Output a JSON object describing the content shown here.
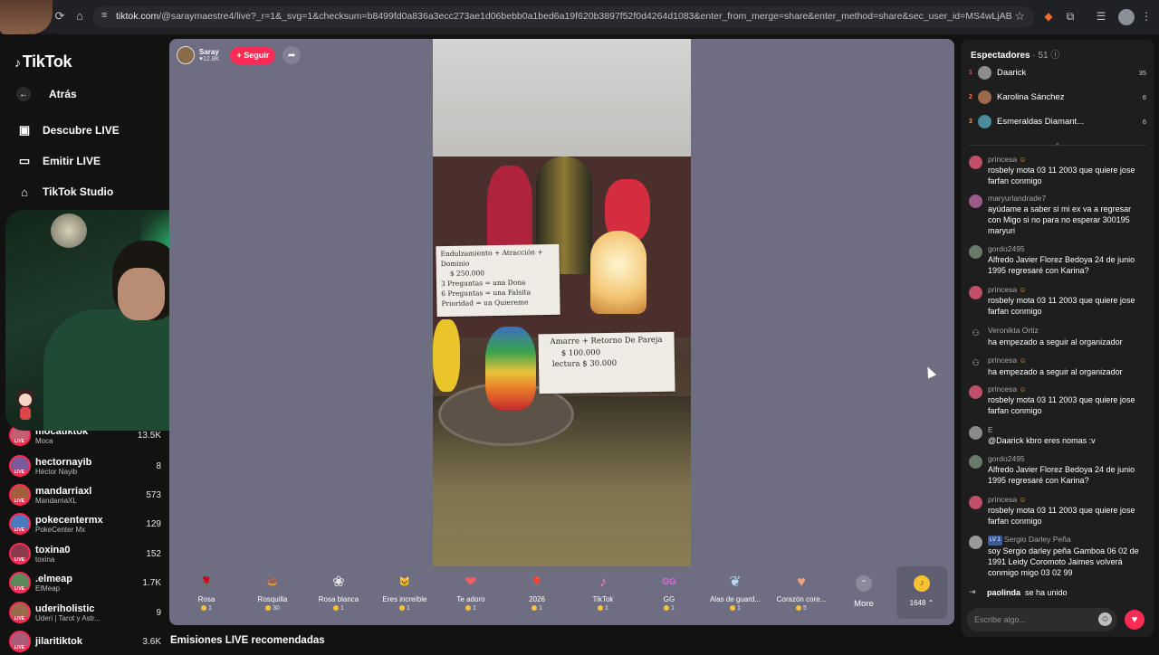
{
  "browser": {
    "url_host": "tiktok.com",
    "url_rest": "/@saraymaestre4/live?_r=1&_svg=1&checksum=b8499fd0a836a3ecc273ae1d06bebb0a1bed6a19f620b3897f52f0d4264d1083&enter_from_merge=share&enter_method=share&sec_user_id=MS4wLjABAAAAzrDx76MkaB1fEXR_...",
    "icons": [
      "back-icon",
      "reload-icon",
      "home-icon",
      "tune-icon",
      "star-icon",
      "extension-icon",
      "puzzle-icon",
      "media-icon",
      "profile-icon",
      "menu-icon"
    ]
  },
  "streamer_overlay": {
    "tag": "c1272"
  },
  "sidebar": {
    "logo": "TikTok",
    "back": "Atrás",
    "nav": [
      {
        "label": "Descubre LIVE",
        "icon": "live-icon"
      },
      {
        "label": "Emitir LIVE",
        "icon": "camera-icon"
      },
      {
        "label": "TikTok Studio",
        "icon": "studio-icon"
      }
    ],
    "following": [
      {
        "name": "mocatiktok",
        "sub": "Moca",
        "count": "13.5K",
        "color": "#c06070"
      },
      {
        "name": "hectornayib",
        "sub": "Héctor Nayib",
        "count": "8",
        "color": "#7a5a9a"
      },
      {
        "name": "mandarriaxl",
        "sub": "MandarriaXL",
        "count": "573",
        "color": "#a0603a"
      },
      {
        "name": "pokecentermx",
        "sub": "PokeCenter Mx",
        "count": "129",
        "color": "#4a7ac0"
      },
      {
        "name": "toxina0",
        "sub": "toxina",
        "count": "152",
        "color": "#8a3a4a"
      },
      {
        "name": ".elmeap",
        "sub": "ElMeap",
        "count": "1.7K",
        "color": "#5a8a5a"
      },
      {
        "name": "uderiholistic",
        "sub": "Uderi | Tarot y Astr...",
        "count": "9",
        "color": "#9a6a4a"
      },
      {
        "name": "jilaritiktok",
        "sub": "",
        "count": "3.6K",
        "color": "#aa5a7a"
      }
    ],
    "live_tag": "LIVE"
  },
  "host": {
    "name": "Saray",
    "likes": "12.8K",
    "follow_label": "+ Seguir"
  },
  "video_cards": {
    "card1": [
      "Endulzamiento + Atracción + Dominio",
      "$ 250.000",
      "3 Preguntas = una Dona",
      "6 Preguntas = una Falsita",
      "Prioridad = un Quiereme"
    ],
    "card2": [
      "Amarre + Retorno De Pareja",
      "$ 100.000",
      "lectura $ 30.000"
    ]
  },
  "gifts": [
    {
      "name": "Rosa",
      "price": "1",
      "icon": "rose-icon",
      "glyph": "🌹",
      "color": "#e63b58"
    },
    {
      "name": "Rosquilla",
      "price": "30",
      "icon": "donut-icon",
      "glyph": "🍩",
      "color": "#f29ab0"
    },
    {
      "name": "Rosa blanca",
      "price": "1",
      "icon": "white-rose-icon",
      "glyph": "❀",
      "color": "#e8e8e8"
    },
    {
      "name": "Eres increíble",
      "price": "1",
      "icon": "cat-icon",
      "glyph": "🐱",
      "color": "#c9a37a"
    },
    {
      "name": "Te adoro",
      "price": "1",
      "icon": "heart-face-icon",
      "glyph": "❤",
      "color": "#f06262"
    },
    {
      "name": "2026",
      "price": "1",
      "icon": "balloons-icon",
      "glyph": "🎈",
      "color": "#f2b441"
    },
    {
      "name": "TikTok",
      "price": "1",
      "icon": "tiktok-icon",
      "glyph": "♪",
      "color": "#ff7fbf"
    },
    {
      "name": "GG",
      "price": "1",
      "icon": "gg-icon",
      "glyph": "GG",
      "color": "#d86ad6"
    },
    {
      "name": "Alas de guard...",
      "price": "1",
      "icon": "wings-icon",
      "glyph": "❦",
      "color": "#b9d8f5"
    },
    {
      "name": "Corazón core...",
      "price": "5",
      "icon": "finger-heart-icon",
      "glyph": "♥",
      "color": "#f3a17a"
    }
  ],
  "more_label": "More",
  "coins": "1648",
  "recommended": "Emisiones LIVE recomendadas",
  "viewers": {
    "title": "Espectadores",
    "count": "51",
    "top": [
      {
        "rank": "1",
        "name": "Daarick",
        "score": "35",
        "rank_color": "#ff4d6d",
        "color": "#8c8c8c"
      },
      {
        "rank": "2",
        "name": "Karolina Sánchez",
        "score": "6",
        "rank_color": "#ff7a4d",
        "color": "#9a6a4a"
      },
      {
        "rank": "3",
        "name": "Esmeraldas Diamant...",
        "score": "6",
        "rank_color": "#ff9a4d",
        "color": "#4a8a9a"
      }
    ]
  },
  "chat": [
    {
      "user": "princesa",
      "text": "rosbely mota 03 11 2003 que quiere jose farfan conmigo",
      "color": "#c0506a",
      "emoji": true
    },
    {
      "user": "maryurlandrade7",
      "text": "ayúdame a saber si mi ex va a regresar con Migo si no para no esperar 300195 maryuri",
      "color": "#9a5a8a"
    },
    {
      "user": "gordo2495",
      "text": "Alfredo Javier Florez Bedoya 24 de junio 1995 regresaré con Karina?",
      "color": "#6a7a6a"
    },
    {
      "user": "princesa",
      "text": "rosbely mota 03 11 2003 que quiere jose farfan conmigo",
      "color": "#c0506a",
      "emoji": true
    },
    {
      "user": "Veronikta Ortiz",
      "text": "ha empezado a seguir al organizador",
      "system": true
    },
    {
      "user": "princesa",
      "text": "ha empezado a seguir al organizador",
      "system": true,
      "emoji": true
    },
    {
      "user": "princesa",
      "text": "rosbely mota 03 11 2003 que quiere jose farfan conmigo",
      "color": "#c0506a",
      "emoji": true
    },
    {
      "user": "E",
      "text": "@Daarick kbro eres nomas :v",
      "color": "#8a8a8a"
    },
    {
      "user": "gordo2495",
      "text": "Alfredo Javier Florez Bedoya 24 de junio 1995 regresaré con Karina?",
      "color": "#6a7a6a"
    },
    {
      "user": "princesa",
      "text": "rosbely mota 03 11 2003 que quiere jose farfan conmigo",
      "color": "#c0506a",
      "emoji": true
    },
    {
      "user": "Sergio Darley Peña",
      "badge": "LV 1",
      "text": "soy Sergio darley peña Gamboa 06 02 de 1991 Leidy Coromoto Jaimes volverá conmigo migo 03 02 99",
      "color": "#9a9a9a"
    }
  ],
  "joined": {
    "user": "paolinda",
    "text": "se ha unido"
  },
  "comment": {
    "placeholder": "Escribe algo..."
  }
}
